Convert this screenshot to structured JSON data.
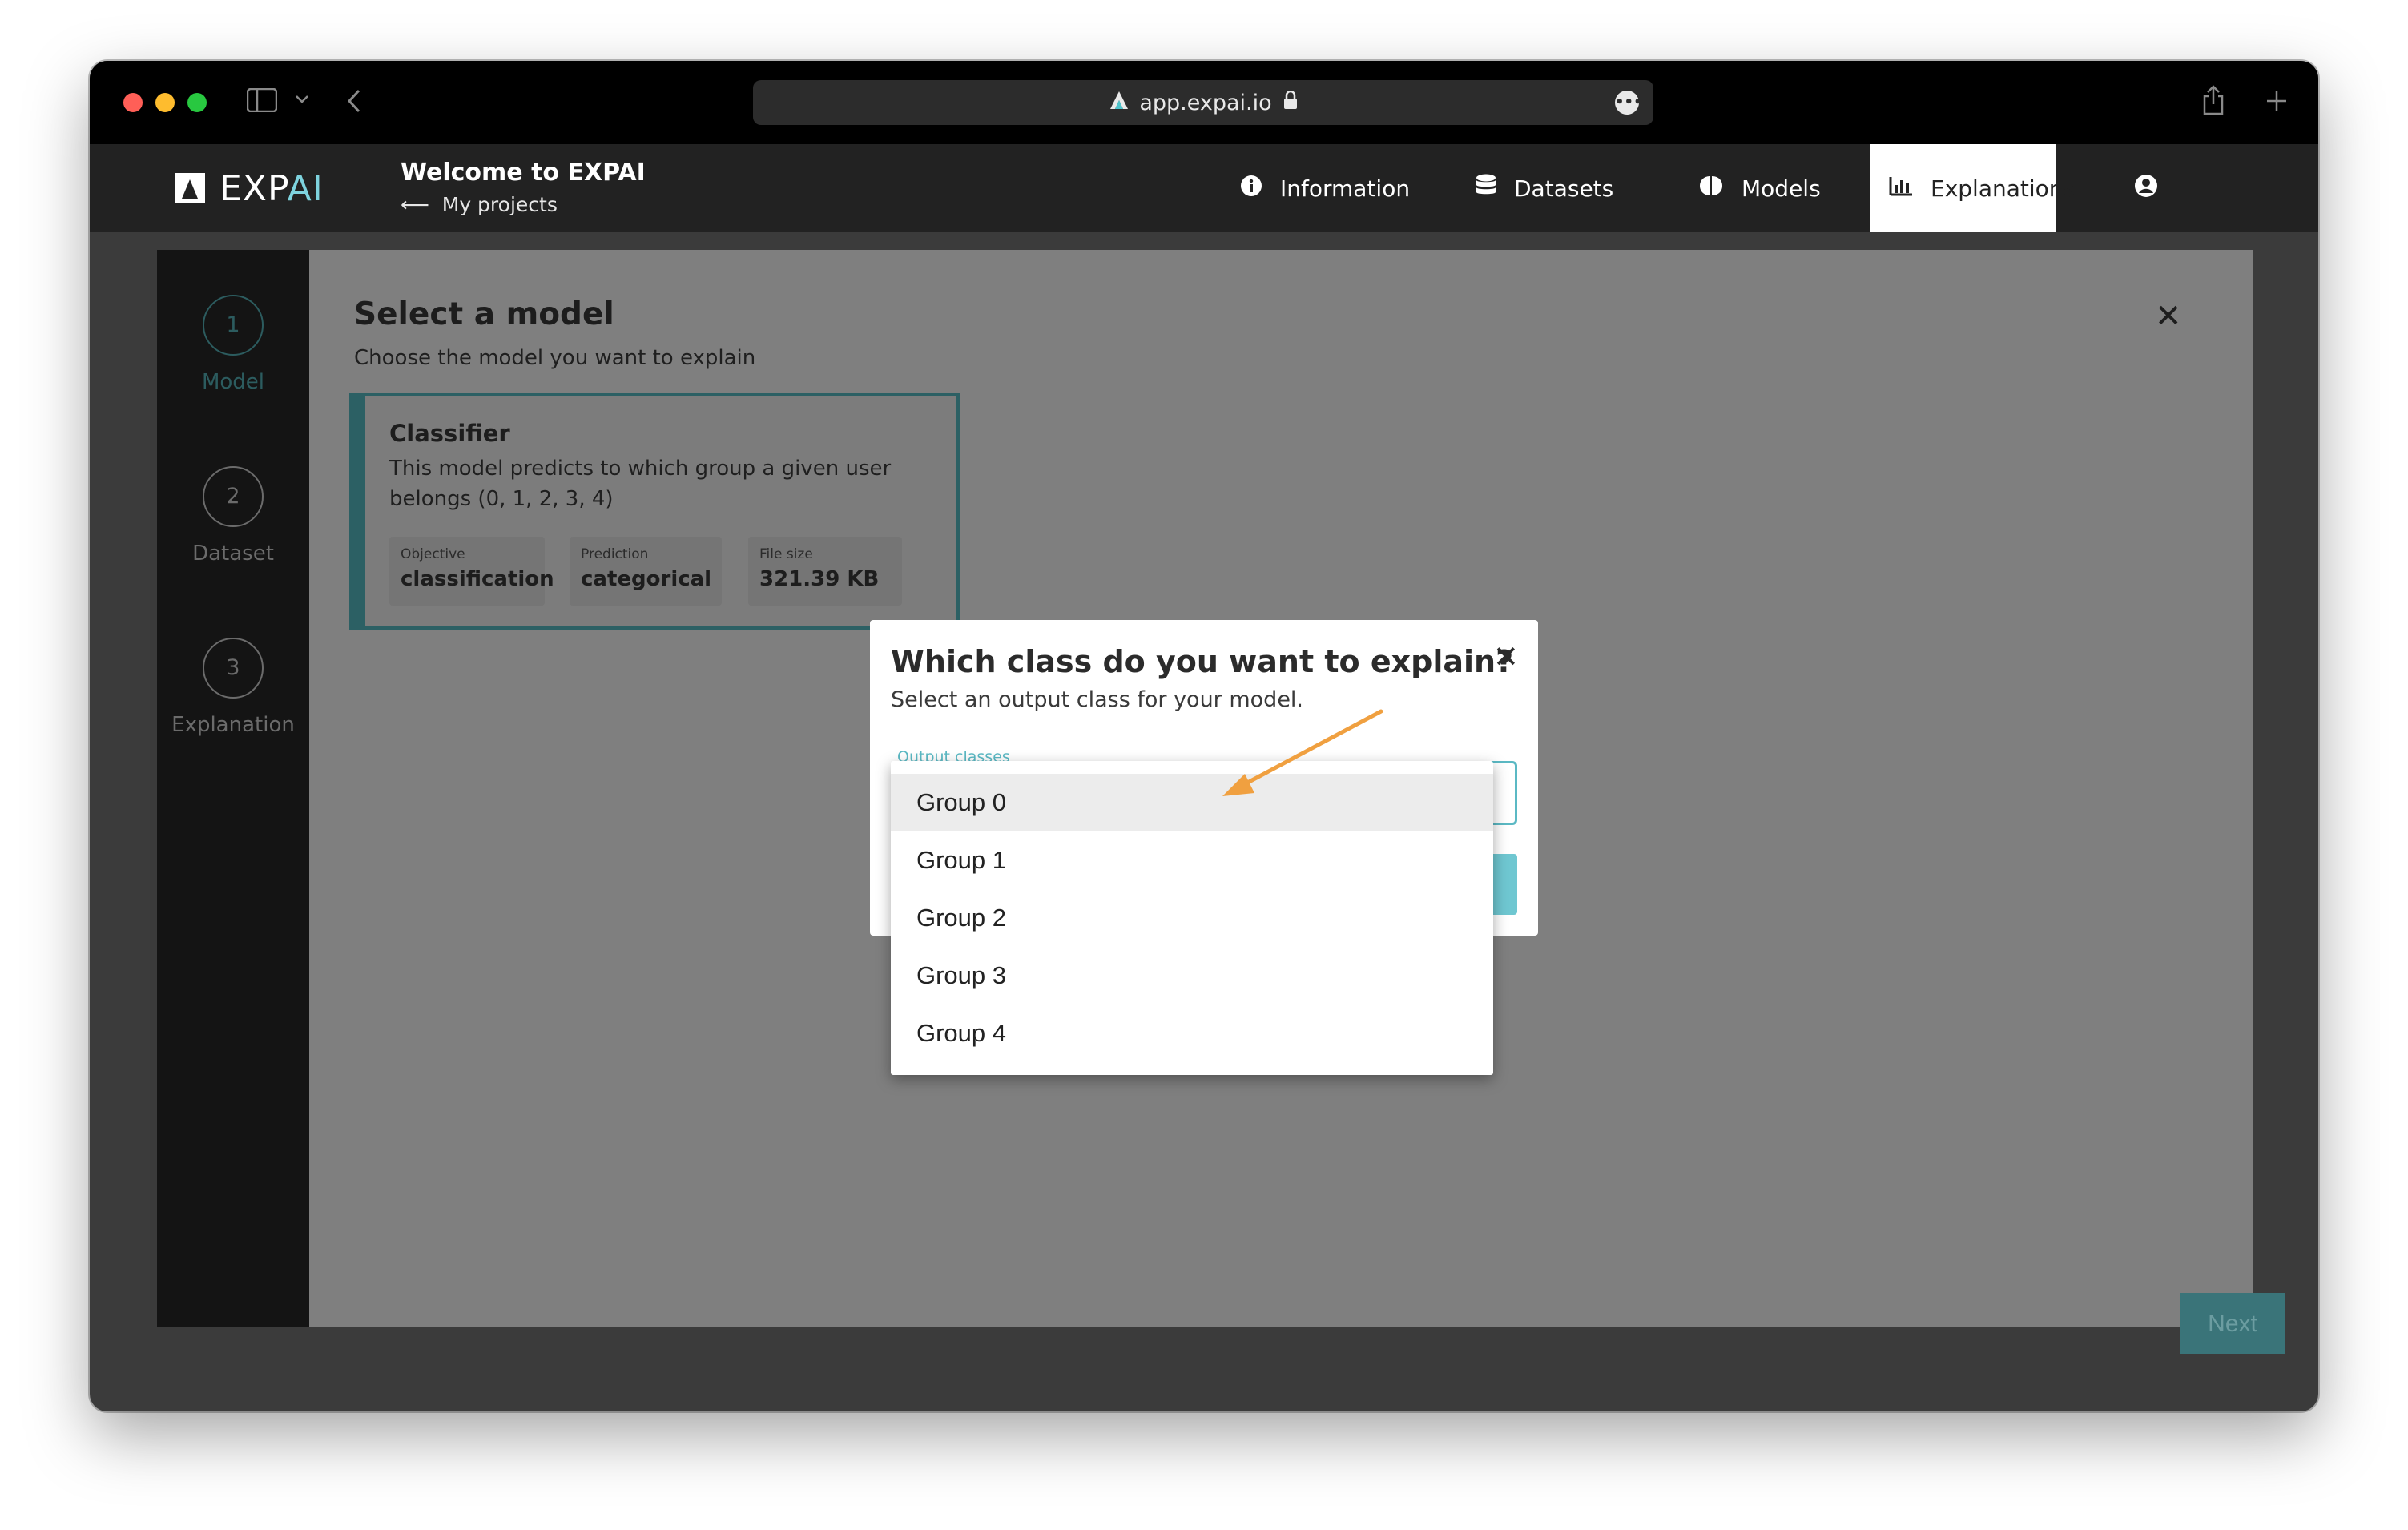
{
  "browser": {
    "url": "app.expai.io",
    "url_logo": "Λ",
    "traffic_lights": {
      "close": "#ff5f57",
      "minimize": "#febc2e",
      "zoom": "#28c840"
    }
  },
  "app": {
    "logo_text_main": "EXP",
    "logo_text_accent": "AI",
    "welcome_title": "Welcome to EXPAI",
    "back_link": "My projects",
    "nav": [
      {
        "label": "Information",
        "icon": "info-icon"
      },
      {
        "label": "Datasets",
        "icon": "database-icon"
      },
      {
        "label": "Models",
        "icon": "brain-icon"
      },
      {
        "label": "Explanations",
        "icon": "bar-chart-icon",
        "active": true
      }
    ],
    "account_icon": "user-circle-icon",
    "accent_color": "#6fc7d1"
  },
  "steps": [
    {
      "number": "1",
      "label": "Model",
      "active": true
    },
    {
      "number": "2",
      "label": "Dataset"
    },
    {
      "number": "3",
      "label": "Explanation"
    }
  ],
  "panel": {
    "title": "Select a model",
    "subtitle": "Choose the model you want to explain",
    "next_label": "Next"
  },
  "model_card": {
    "title": "Classifier",
    "description": "This model predicts to which group a given user belongs (0, 1, 2, 3, 4)",
    "chips": [
      {
        "label": "Objective",
        "value": "classification"
      },
      {
        "label": "Prediction",
        "value": "categorical"
      },
      {
        "label": "File size",
        "value": "321.39 KB"
      }
    ]
  },
  "modal": {
    "title": "Which class do you want to explain?",
    "subtitle": "Select an output class for your model.",
    "field_label": "Output classes"
  },
  "dropdown": {
    "options": [
      "Group 0",
      "Group 1",
      "Group 2",
      "Group 3",
      "Group 4"
    ]
  },
  "annotation_color": "#f0a040"
}
